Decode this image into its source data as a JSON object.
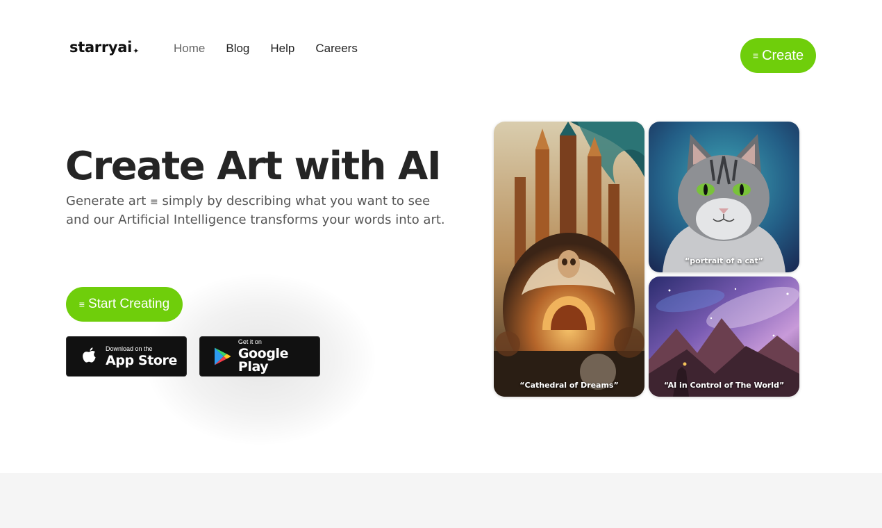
{
  "brand": {
    "logo_text": "starryai",
    "logo_mark": "✦"
  },
  "nav": {
    "items": [
      "Home",
      "Blog",
      "Help",
      "Careers"
    ],
    "active": "Home"
  },
  "header": {
    "create_label": "Create",
    "create_icon": "menu-icon"
  },
  "hero": {
    "title": "Create Art with AI",
    "subtitle_before": "Generate art",
    "subtitle_after": "simply by describing what you want to see and our Artificial Intelligence transforms your words into art.",
    "inline_icon": "menu-icon",
    "start_label": "Start Creating"
  },
  "stores": {
    "appstore_small": "Download on the",
    "appstore_big": "App Store",
    "play_small": "Get it on",
    "play_big": "Google Play"
  },
  "gallery": {
    "cathedral_caption": "“Cathedral of Dreams”",
    "cat_caption": "“portrait of a cat”",
    "space_caption": "“AI in Control of The World”"
  },
  "colors": {
    "accent": "#6fce0b",
    "text_dark": "#252525",
    "text_muted": "#555555",
    "band": "#f5f5f5"
  }
}
